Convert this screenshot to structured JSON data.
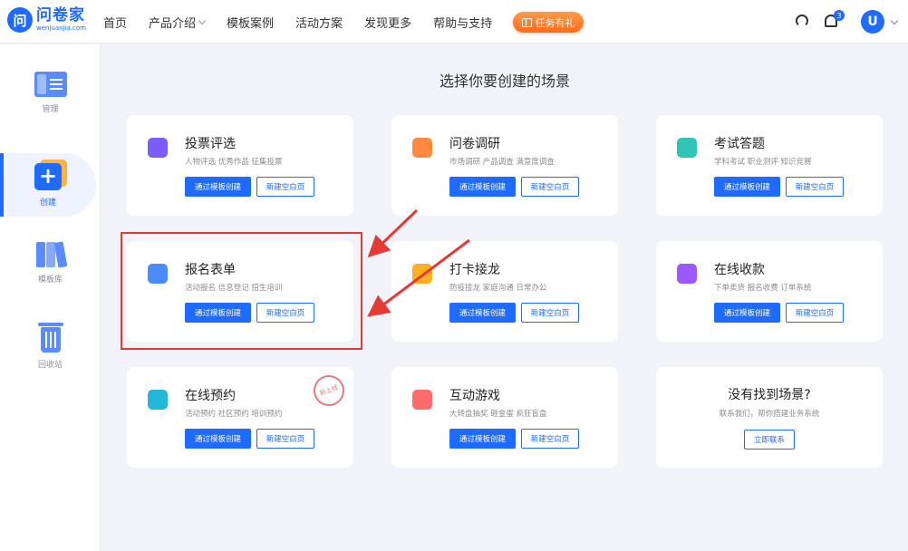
{
  "logo": {
    "mark": "问",
    "name": "问卷家",
    "domain": "wenjuanjia.com"
  },
  "nav": {
    "items": [
      {
        "label": "首页",
        "has_dropdown": false
      },
      {
        "label": "产品介绍",
        "has_dropdown": true
      },
      {
        "label": "模板案例",
        "has_dropdown": false
      },
      {
        "label": "活动方案",
        "has_dropdown": false
      },
      {
        "label": "发现更多",
        "has_dropdown": false
      },
      {
        "label": "帮助与支持",
        "has_dropdown": false
      }
    ],
    "task_button": "任务有礼",
    "notification_count": "3",
    "avatar_letter": "U"
  },
  "sidebar": {
    "items": [
      {
        "label": "管理",
        "icon": "folder-manage-icon",
        "active": false
      },
      {
        "label": "创建",
        "icon": "create-plus-icon",
        "active": true
      },
      {
        "label": "模板库",
        "icon": "template-library-icon",
        "active": false
      },
      {
        "label": "回收站",
        "icon": "recycle-bin-icon",
        "active": false
      }
    ]
  },
  "main": {
    "title": "选择你要创建的场景",
    "primary_button": "通过模板创建",
    "secondary_button": "新建空白页",
    "scenes": [
      {
        "title": "投票评选",
        "desc": "人物评选 优秀作品 征集投票",
        "icon": "vote-icon",
        "color": "#7a5cff"
      },
      {
        "title": "问卷调研",
        "desc": "市场调研 产品调查 满意度调查",
        "icon": "survey-icon",
        "color": "#ff8a3d"
      },
      {
        "title": "考试答题",
        "desc": "学科考试 职业测评 知识竞赛",
        "icon": "exam-icon",
        "color": "#2ec5b6"
      },
      {
        "title": "报名表单",
        "desc": "活动报名 信息登记 招生培训",
        "icon": "form-grid-icon",
        "color": "#4a8bff"
      },
      {
        "title": "打卡接龙",
        "desc": "防疫接龙 家庭沟通 日常办公",
        "icon": "checkin-icon",
        "color": "#ffb020"
      },
      {
        "title": "在线收款",
        "desc": "下单卖货 报名收费 订单系统",
        "icon": "payment-icon",
        "color": "#9b59ff"
      },
      {
        "title": "在线预约",
        "desc": "活动预约 社区预约 培训预约",
        "icon": "calendar-icon",
        "color": "#22b8d8",
        "stamp": "新上线"
      },
      {
        "title": "互动游戏",
        "desc": "大转盘抽奖 砸金蛋 疯狂盲盒",
        "icon": "gift-icon",
        "color": "#ff6b6b"
      }
    ],
    "not_found": {
      "title": "没有找到场景?",
      "desc": "联系我们，帮你搭建业务系统",
      "button": "立即联系"
    }
  }
}
